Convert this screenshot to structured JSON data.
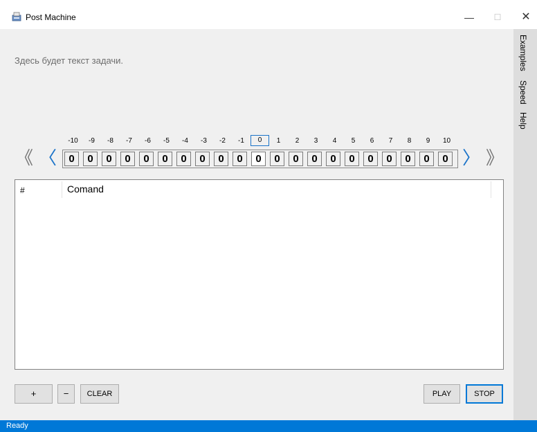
{
  "window": {
    "title": "Post Machine",
    "minimize_glyph": "—",
    "maximize_glyph": "☐",
    "close_glyph": "✕"
  },
  "task": {
    "text": "Здесь будет текст задачи."
  },
  "menu": {
    "examples": "Examples",
    "speed": "Speed",
    "help": "Help"
  },
  "tape": {
    "indices": [
      "-10",
      "-9",
      "-8",
      "-7",
      "-6",
      "-5",
      "-4",
      "-3",
      "-2",
      "-1",
      "0",
      "1",
      "2",
      "3",
      "4",
      "5",
      "6",
      "7",
      "8",
      "9",
      "10"
    ],
    "cells": [
      "0",
      "0",
      "0",
      "0",
      "0",
      "0",
      "0",
      "0",
      "0",
      "0",
      "0",
      "0",
      "0",
      "0",
      "0",
      "0",
      "0",
      "0",
      "0",
      "0",
      "0"
    ],
    "current_index": 10,
    "nav_first": "《",
    "nav_prev": "〈",
    "nav_next": "〉",
    "nav_last": "》"
  },
  "table": {
    "col_num": "#",
    "col_command": "Comand"
  },
  "buttons": {
    "add": "+",
    "remove": "−",
    "clear": "CLEAR",
    "play": "PLAY",
    "stop": "STOP"
  },
  "status": {
    "text": "Ready"
  },
  "colors": {
    "accent": "#0078d7",
    "current_cell_border": "#1a73c9"
  },
  "icons": {
    "app": "post-machine-app-icon"
  }
}
